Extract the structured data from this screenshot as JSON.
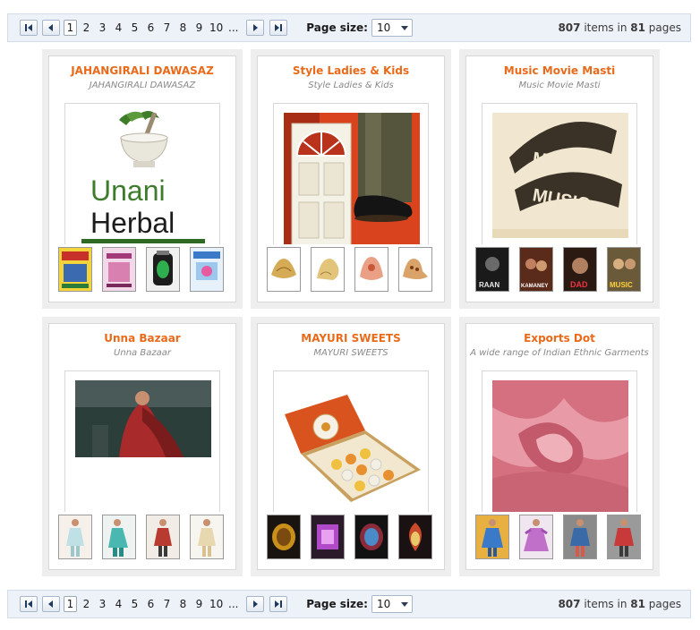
{
  "pager": {
    "pages": [
      "1",
      "2",
      "3",
      "4",
      "5",
      "6",
      "7",
      "8",
      "9",
      "10",
      "..."
    ],
    "current": "1",
    "page_size_label": "Page size:",
    "page_size_value": "10",
    "items_count": "807",
    "items_text": " items in ",
    "pages_count": "81",
    "pages_text": " pages"
  },
  "stores": [
    {
      "title": "JAHANGIRALI DAWASAZ",
      "subtitle": "JAHANGIRALI DAWASAZ",
      "logo_text_1": "Unani",
      "logo_text_2": "Herbal"
    },
    {
      "title": "Style Ladies & Kids",
      "subtitle": "Style Ladies & Kids"
    },
    {
      "title": "Music Movie Masti",
      "subtitle": "Music Movie Masti",
      "film_text_1": "MOVIE",
      "film_text_2": "MUSIC"
    },
    {
      "title": "Unna Bazaar",
      "subtitle": "Unna Bazaar"
    },
    {
      "title": "MAYURI SWEETS",
      "subtitle": "MAYURI SWEETS"
    },
    {
      "title": "Exports Dot",
      "subtitle": "A wide range of Indian Ethnic Garments"
    }
  ],
  "thumb_texts": {
    "movie": [
      "RAAN",
      "KAMANEY",
      "DAD",
      "MUSIC"
    ]
  }
}
